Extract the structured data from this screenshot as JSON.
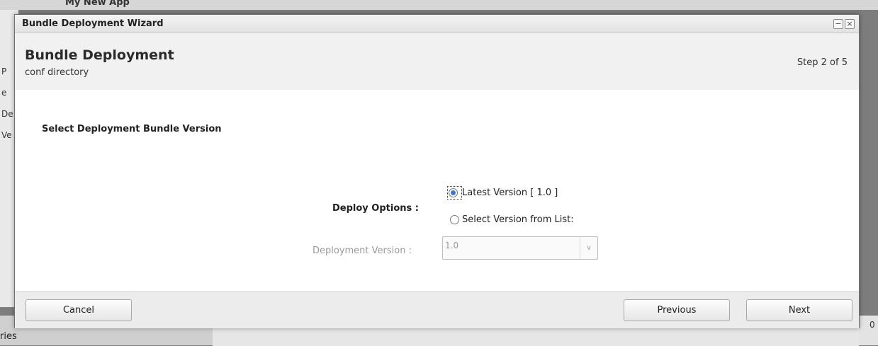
{
  "background": {
    "app_title": "My New App",
    "left_letters": [
      "P",
      "e",
      "De",
      "Ve"
    ],
    "bottom_text": "ries",
    "right_text": "0"
  },
  "dialog": {
    "title": "Bundle Deployment Wizard",
    "header": {
      "title": "Bundle Deployment",
      "subtitle": "conf directory",
      "step": "Step 2 of 5"
    },
    "section_title": "Select Deployment Bundle Version",
    "deploy_options_label": "Deploy Options :",
    "options": [
      {
        "label": "Latest Version [ 1.0 ]",
        "selected": true
      },
      {
        "label": "Select Version from List:",
        "selected": false
      }
    ],
    "version_label": "Deployment Version :",
    "version_value": "1.0",
    "buttons": {
      "cancel": "Cancel",
      "previous": "Previous",
      "next": "Next"
    },
    "window_buttons": {
      "minimize": "−",
      "close": "×"
    }
  }
}
